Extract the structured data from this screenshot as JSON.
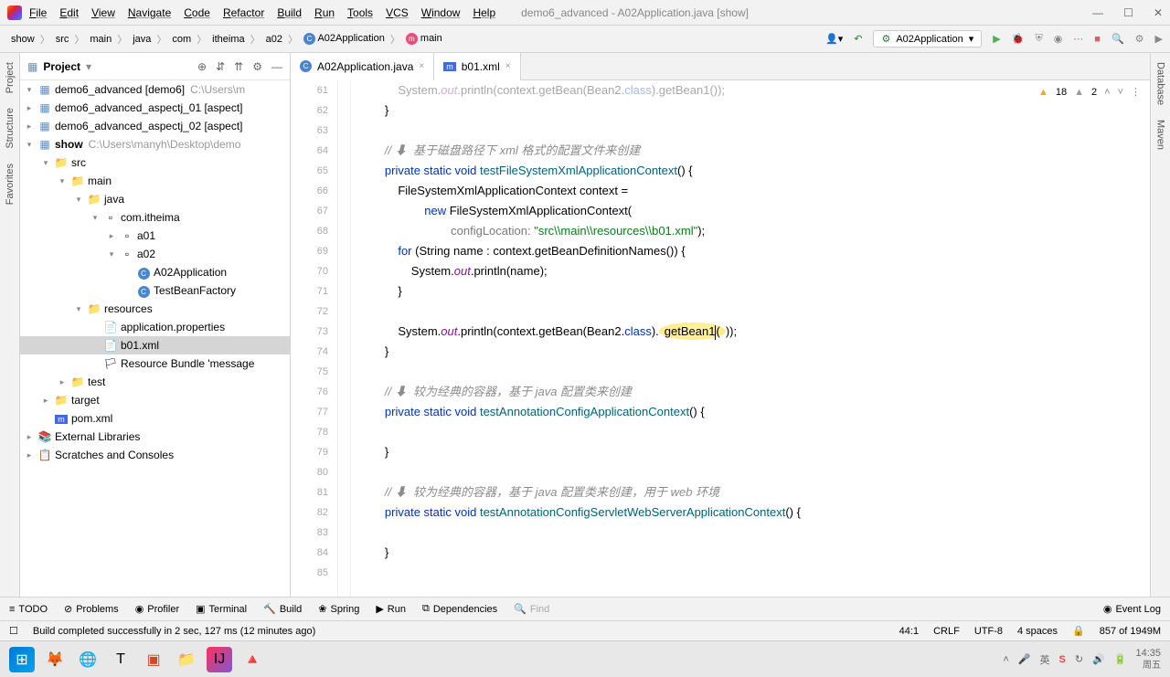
{
  "title": "demo6_advanced - A02Application.java [show]",
  "menu": [
    "File",
    "Edit",
    "View",
    "Navigate",
    "Code",
    "Refactor",
    "Build",
    "Run",
    "Tools",
    "VCS",
    "Window",
    "Help"
  ],
  "breadcrumbs": [
    "show",
    "src",
    "main",
    "java",
    "com",
    "itheima",
    "a02"
  ],
  "breadcrumb_class": "A02Application",
  "breadcrumb_method": "main",
  "run_config": "A02Application",
  "panel_title": "Project",
  "tree": [
    {
      "depth": 0,
      "arrow": "▾",
      "icon": "mod",
      "label": "demo6_advanced [demo6]",
      "hint": "C:\\Users\\m"
    },
    {
      "depth": 0,
      "arrow": "▸",
      "icon": "mod",
      "label": "demo6_advanced_aspectj_01 [aspect]"
    },
    {
      "depth": 0,
      "arrow": "▸",
      "icon": "mod",
      "label": "demo6_advanced_aspectj_02 [aspect]"
    },
    {
      "depth": 0,
      "arrow": "▾",
      "icon": "mod",
      "label": "show",
      "bold": true,
      "hint": "C:\\Users\\manyh\\Desktop\\demo"
    },
    {
      "depth": 1,
      "arrow": "▾",
      "icon": "folder",
      "label": "src"
    },
    {
      "depth": 2,
      "arrow": "▾",
      "icon": "folder",
      "label": "main"
    },
    {
      "depth": 3,
      "arrow": "▾",
      "icon": "folder",
      "label": "java"
    },
    {
      "depth": 4,
      "arrow": "▾",
      "icon": "pkg",
      "label": "com.itheima"
    },
    {
      "depth": 5,
      "arrow": "▸",
      "icon": "pkg",
      "label": "a01"
    },
    {
      "depth": 5,
      "arrow": "▾",
      "icon": "pkg",
      "label": "a02"
    },
    {
      "depth": 6,
      "arrow": "",
      "icon": "class",
      "label": "A02Application"
    },
    {
      "depth": 6,
      "arrow": "",
      "icon": "class",
      "label": "TestBeanFactory"
    },
    {
      "depth": 3,
      "arrow": "▾",
      "icon": "res",
      "label": "resources"
    },
    {
      "depth": 4,
      "arrow": "",
      "icon": "file",
      "label": "application.properties"
    },
    {
      "depth": 4,
      "arrow": "",
      "icon": "xml",
      "label": "b01.xml",
      "selected": true
    },
    {
      "depth": 4,
      "arrow": "",
      "icon": "bundle",
      "label": "Resource Bundle 'message"
    },
    {
      "depth": 2,
      "arrow": "▸",
      "icon": "folder",
      "label": "test"
    },
    {
      "depth": 1,
      "arrow": "▸",
      "icon": "target",
      "label": "target"
    },
    {
      "depth": 1,
      "arrow": "",
      "icon": "pom",
      "label": "pom.xml"
    },
    {
      "depth": 0,
      "arrow": "▸",
      "icon": "lib",
      "label": "External Libraries"
    },
    {
      "depth": 0,
      "arrow": "▸",
      "icon": "scratch",
      "label": "Scratches and Consoles"
    }
  ],
  "tabs": [
    {
      "icon": "class",
      "label": "A02Application.java"
    },
    {
      "icon": "xml",
      "label": "b01.xml"
    }
  ],
  "inspection": {
    "warn1": "18",
    "warn2": "2"
  },
  "lines_start": 61,
  "code_lines": [
    {
      "n": 61,
      "html": "            System.<span class='fld'>out</span>.println(context.getBean(Bean2.<span class='kw'>class</span>).getBean1());",
      "faded": true
    },
    {
      "n": 62,
      "html": "        }"
    },
    {
      "n": 63,
      "html": ""
    },
    {
      "n": 64,
      "html": "        <span class='com'>// ⬇  基于磁盘路径下 xml 格式的配置文件来创建</span>"
    },
    {
      "n": 65,
      "html": "        <span class='kw'>private static void</span> <span class='mname'>testFileSystemXmlApplicationContext</span>() {"
    },
    {
      "n": 66,
      "html": "            FileSystemXmlApplicationContext context ="
    },
    {
      "n": 67,
      "html": "                    <span class='kw'>new</span> FileSystemXmlApplicationContext("
    },
    {
      "n": 68,
      "html": "                            <span class='param'>configLocation:</span> <span class='str'>\"src\\\\main\\\\resources\\\\b01.xml\"</span>);"
    },
    {
      "n": 69,
      "html": "            <span class='kw'>for</span> (String name : context.getBeanDefinitionNames()) {"
    },
    {
      "n": 70,
      "html": "                System.<span class='fld'>out</span>.println(name);"
    },
    {
      "n": 71,
      "html": "            }"
    },
    {
      "n": 72,
      "html": ""
    },
    {
      "n": 73,
      "html": "            System.<span class='fld'>out</span>.println(context.getBean(Bean2.<span class='kw'>class</span>).<span class='hl'>getBean1<span class='caret-indicator'></span>(</span>));"
    },
    {
      "n": 74,
      "html": "        }"
    },
    {
      "n": 75,
      "html": ""
    },
    {
      "n": 76,
      "html": "        <span class='com'>// ⬇  较为经典的容器，基于 java 配置类来创建</span>"
    },
    {
      "n": 77,
      "html": "        <span class='kw'>private static void</span> <span class='mname'>testAnnotationConfigApplicationContext</span>() {"
    },
    {
      "n": 78,
      "html": ""
    },
    {
      "n": 79,
      "html": "        }"
    },
    {
      "n": 80,
      "html": ""
    },
    {
      "n": 81,
      "html": "        <span class='com'>// ⬇  较为经典的容器，基于 java 配置类来创建，用于 web 环境</span>"
    },
    {
      "n": 82,
      "html": "        <span class='kw'>private static void</span> <span class='mname'>testAnnotationConfigServletWebServerApplicationContext</span>() {"
    },
    {
      "n": 83,
      "html": ""
    },
    {
      "n": 84,
      "html": "        }"
    },
    {
      "n": 85,
      "html": ""
    }
  ],
  "bottom": {
    "todo": "TODO",
    "problems": "Problems",
    "profiler": "Profiler",
    "terminal": "Terminal",
    "build": "Build",
    "spring": "Spring",
    "run": "Run",
    "dependencies": "Dependencies",
    "find": "Find",
    "eventlog": "Event Log"
  },
  "status": {
    "msg": "Build completed successfully in 2 sec, 127 ms (12 minutes ago)",
    "pos": "44:1",
    "eol": "CRLF",
    "enc": "UTF-8",
    "indent": "4 spaces",
    "mem": "857 of 1949M"
  },
  "clock": {
    "time": "14:35",
    "date": "周五"
  },
  "left_tools": [
    "Project",
    "Structure",
    "Favorites"
  ],
  "right_tools": [
    "Database",
    "Maven"
  ]
}
